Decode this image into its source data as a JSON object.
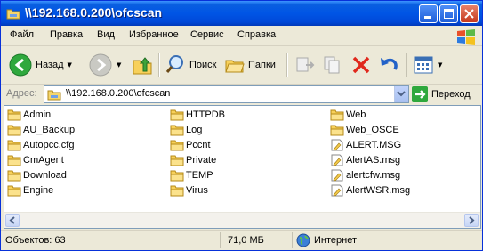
{
  "window": {
    "title": "\\\\192.168.0.200\\ofcscan"
  },
  "menu": {
    "items": [
      {
        "label": "Файл"
      },
      {
        "label": "Правка"
      },
      {
        "label": "Вид"
      },
      {
        "label": "Избранное"
      },
      {
        "label": "Сервис"
      },
      {
        "label": "Справка"
      }
    ]
  },
  "toolbar": {
    "back_label": "Назад",
    "search_label": "Поиск",
    "folders_label": "Папки"
  },
  "address": {
    "label": "Адрес:",
    "value": "\\\\192.168.0.200\\ofcscan",
    "go_label": "Переход"
  },
  "files": {
    "col1": [
      {
        "name": "Admin",
        "type": "folder"
      },
      {
        "name": "AU_Backup",
        "type": "folder"
      },
      {
        "name": "Autopcc.cfg",
        "type": "folder"
      },
      {
        "name": "CmAgent",
        "type": "folder"
      },
      {
        "name": "Download",
        "type": "folder"
      },
      {
        "name": "Engine",
        "type": "folder"
      }
    ],
    "col2": [
      {
        "name": "HTTPDB",
        "type": "folder"
      },
      {
        "name": "Log",
        "type": "folder"
      },
      {
        "name": "Pccnt",
        "type": "folder"
      },
      {
        "name": "Private",
        "type": "folder"
      },
      {
        "name": "TEMP",
        "type": "folder"
      },
      {
        "name": "Virus",
        "type": "folder"
      }
    ],
    "col3": [
      {
        "name": "Web",
        "type": "folder"
      },
      {
        "name": "Web_OSCE",
        "type": "folder"
      },
      {
        "name": "ALERT.MSG",
        "type": "file"
      },
      {
        "name": "AlertAS.msg",
        "type": "file"
      },
      {
        "name": "alertcfw.msg",
        "type": "file"
      },
      {
        "name": "AlertWSR.msg",
        "type": "file"
      }
    ]
  },
  "status": {
    "objects": "Объектов: 63",
    "size": "71,0 МБ",
    "zone": "Интернет"
  }
}
